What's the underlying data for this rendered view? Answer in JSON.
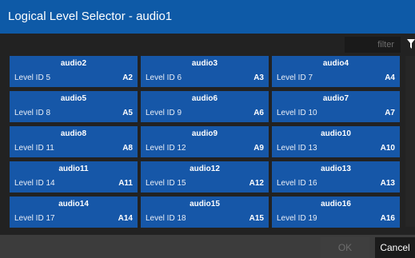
{
  "dialog": {
    "title": "Logical Level Selector - audio1"
  },
  "filter": {
    "label": "filter",
    "icon": "filter-icon"
  },
  "levels": [
    {
      "name": "audio2",
      "level": "Level ID 5",
      "code": "A2"
    },
    {
      "name": "audio3",
      "level": "Level ID 6",
      "code": "A3"
    },
    {
      "name": "audio4",
      "level": "Level ID 7",
      "code": "A4"
    },
    {
      "name": "audio5",
      "level": "Level ID 8",
      "code": "A5"
    },
    {
      "name": "audio6",
      "level": "Level ID 9",
      "code": "A6"
    },
    {
      "name": "audio7",
      "level": "Level ID 10",
      "code": "A7"
    },
    {
      "name": "audio8",
      "level": "Level ID 11",
      "code": "A8"
    },
    {
      "name": "audio9",
      "level": "Level ID 12",
      "code": "A9"
    },
    {
      "name": "audio10",
      "level": "Level ID 13",
      "code": "A10"
    },
    {
      "name": "audio11",
      "level": "Level ID 14",
      "code": "A11"
    },
    {
      "name": "audio12",
      "level": "Level ID 15",
      "code": "A12"
    },
    {
      "name": "audio13",
      "level": "Level ID 16",
      "code": "A13"
    },
    {
      "name": "audio14",
      "level": "Level ID 17",
      "code": "A14"
    },
    {
      "name": "audio15",
      "level": "Level ID 18",
      "code": "A15"
    },
    {
      "name": "audio16",
      "level": "Level ID 19",
      "code": "A16"
    }
  ],
  "buttons": {
    "ok": "OK",
    "cancel": "Cancel"
  },
  "colors": {
    "title_bar": "#0e5aa7",
    "tile": "#1657a8",
    "panel": "#222222",
    "footer": "#3c3c3c"
  }
}
